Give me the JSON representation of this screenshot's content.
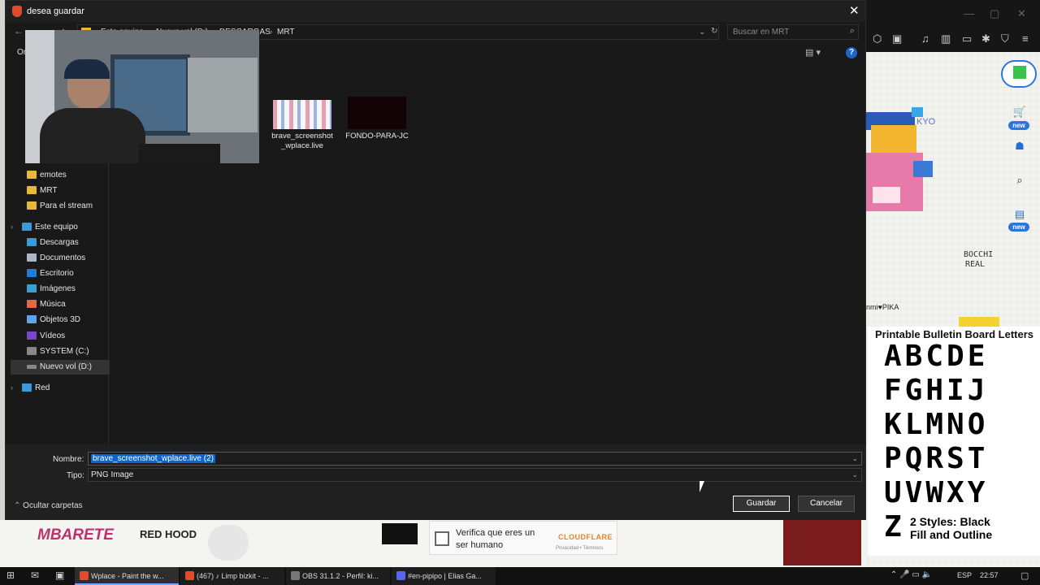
{
  "dialog": {
    "title": "desea guardar",
    "breadcrumb": [
      "Este equipo",
      "Nuevo vol (D:)",
      "DESCARGAS",
      "MRT"
    ],
    "search_placeholder": "Buscar en MRT",
    "organize_label": "Or"
  },
  "nav_pane": {
    "items": [
      {
        "label": "emotes",
        "icon": "folder-icon"
      },
      {
        "label": "MRT",
        "icon": "folder-icon"
      },
      {
        "label": "Para el stream",
        "icon": "folder-icon"
      },
      {
        "label": "Este equipo",
        "icon": "pc-icon"
      },
      {
        "label": "Descargas",
        "icon": "download-icon"
      },
      {
        "label": "Documentos",
        "icon": "documents-icon"
      },
      {
        "label": "Escritorio",
        "icon": "desktop-icon"
      },
      {
        "label": "Imágenes",
        "icon": "pictures-icon"
      },
      {
        "label": "Música",
        "icon": "music-icon"
      },
      {
        "label": "Objetos 3D",
        "icon": "objects-3d-icon"
      },
      {
        "label": "Vídeos",
        "icon": "videos-icon"
      },
      {
        "label": "SYSTEM (C:)",
        "icon": "drive-icon"
      },
      {
        "label": "Nuevo vol (D:)",
        "icon": "drive-icon"
      },
      {
        "label": "Red",
        "icon": "network-icon"
      }
    ]
  },
  "files": [
    {
      "name": "brave_screenshot_wplace.live",
      "line1": "brave_screenshot",
      "line2": "_wplace.live"
    },
    {
      "name": "FONDO-PARA-JC",
      "line1": "FONDO-PARA-JC",
      "line2": ""
    }
  ],
  "save_panel": {
    "name_label": "Nombre:",
    "name_value": "brave_screenshot_wplace.live (2)",
    "type_label": "Tipo:",
    "type_value": "PNG Image",
    "hide_folders": "Ocultar carpetas",
    "save_button": "Guardar",
    "cancel_button": "Cancelar"
  },
  "background": {
    "captcha_label": "Verifica que eres un ser humano",
    "captcha_brand": "CLOUDFLARE",
    "captcha_links": "Privacidad • Términos",
    "map_texts": [
      "MBARETE",
      "RED HOOD",
      "BOCCHI",
      "REAL",
      "KYO",
      "nmi♥PIKA"
    ],
    "letters_title": "Printable Bulletin Board Letters",
    "letters_rows": [
      "ABCDE",
      "FGHIJ",
      "KLMNO",
      "PQRST",
      "UVWXY",
      "Z"
    ],
    "letters_footer_1": "2 Styles: Black",
    "letters_footer_2": "Fill and Outline",
    "new_badge": "new"
  },
  "taskbar": {
    "items": [
      {
        "label": "Wplace - Paint the w...",
        "color": "#e24a2c"
      },
      {
        "label": "(467) ♪ Limp bizkit - ...",
        "color": "#e24a2c"
      },
      {
        "label": "OBS 31.1.2 - Perfil: ki...",
        "color": "#777777"
      },
      {
        "label": "#en-pipipo | Elias Ga...",
        "color": "#5865f2"
      }
    ],
    "language": "ESP",
    "time": "22:57"
  }
}
